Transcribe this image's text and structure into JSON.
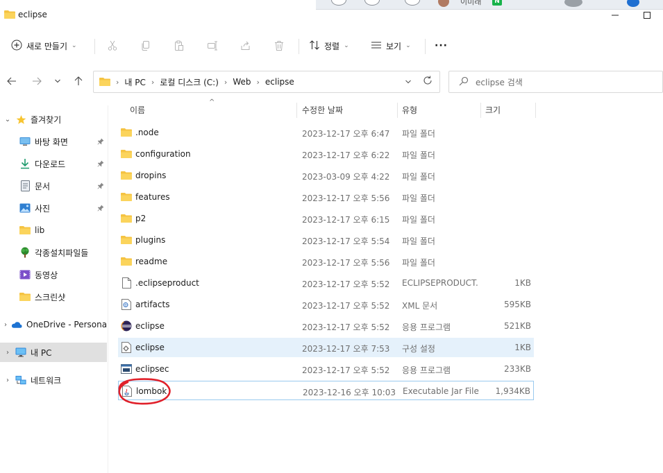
{
  "window": {
    "title": "eclipse",
    "top_strip_text": "이미래",
    "top_strip_badge": "N"
  },
  "toolbar": {
    "new_label": "새로 만들기",
    "sort_label": "정렬",
    "view_label": "보기",
    "more_label": "···"
  },
  "address": {
    "crumbs": [
      "내 PC",
      "로컬 디스크 (C:)",
      "Web",
      "eclipse"
    ]
  },
  "search": {
    "placeholder": "eclipse 검색"
  },
  "sidebar": {
    "items": [
      {
        "label": "즐겨찾기",
        "icon": "star-icon"
      },
      {
        "label": "바탕 화면",
        "icon": "desktop-icon"
      },
      {
        "label": "다운로드",
        "icon": "download-icon"
      },
      {
        "label": "문서",
        "icon": "document-icon"
      },
      {
        "label": "사진",
        "icon": "pictures-icon"
      },
      {
        "label": "lib",
        "icon": "folder-icon"
      },
      {
        "label": "각종설치파일들",
        "icon": "tree-icon"
      },
      {
        "label": "동영상",
        "icon": "video-icon"
      },
      {
        "label": "스크린샷",
        "icon": "folder-icon"
      },
      {
        "label": "OneDrive - Persona",
        "icon": "cloud-icon"
      },
      {
        "label": "내 PC",
        "icon": "pc-icon"
      },
      {
        "label": "네트워크",
        "icon": "network-icon"
      }
    ]
  },
  "columns": {
    "name": "이름",
    "modified": "수정한 날짜",
    "type": "유형",
    "size": "크기"
  },
  "files": [
    {
      "name": ".node",
      "modified": "2023-12-17 오후 6:47",
      "type": "파일 폴더",
      "size": "",
      "icon": "folder-icon"
    },
    {
      "name": "configuration",
      "modified": "2023-12-17 오후 6:22",
      "type": "파일 폴더",
      "size": "",
      "icon": "folder-icon"
    },
    {
      "name": "dropins",
      "modified": "2023-03-09 오후 4:22",
      "type": "파일 폴더",
      "size": "",
      "icon": "folder-icon"
    },
    {
      "name": "features",
      "modified": "2023-12-17 오후 5:56",
      "type": "파일 폴더",
      "size": "",
      "icon": "folder-icon"
    },
    {
      "name": "p2",
      "modified": "2023-12-17 오후 6:15",
      "type": "파일 폴더",
      "size": "",
      "icon": "folder-icon"
    },
    {
      "name": "plugins",
      "modified": "2023-12-17 오후 5:54",
      "type": "파일 폴더",
      "size": "",
      "icon": "folder-icon"
    },
    {
      "name": "readme",
      "modified": "2023-12-17 오후 5:56",
      "type": "파일 폴더",
      "size": "",
      "icon": "folder-icon"
    },
    {
      "name": ".eclipseproduct",
      "modified": "2023-12-17 오후 5:52",
      "type": "ECLIPSEPRODUCT...",
      "size": "1KB",
      "icon": "blank-file-icon"
    },
    {
      "name": "artifacts",
      "modified": "2023-12-17 오후 5:52",
      "type": "XML 문서",
      "size": "595KB",
      "icon": "xml-file-icon"
    },
    {
      "name": "eclipse",
      "modified": "2023-12-17 오후 5:52",
      "type": "응용 프로그램",
      "size": "521KB",
      "icon": "eclipse-app-icon"
    },
    {
      "name": "eclipse",
      "modified": "2023-12-17 오후 7:53",
      "type": "구성 설정",
      "size": "1KB",
      "icon": "config-file-icon"
    },
    {
      "name": "eclipsec",
      "modified": "2023-12-17 오후 5:52",
      "type": "응용 프로그램",
      "size": "233KB",
      "icon": "console-app-icon"
    },
    {
      "name": "lombok",
      "modified": "2023-12-16 오후 10:03",
      "type": "Executable Jar File",
      "size": "1,934KB",
      "icon": "jar-file-icon"
    }
  ],
  "colors": {
    "folder": "#f5c342",
    "selection": "#e5f1fb",
    "annotation": "#e0202a"
  }
}
